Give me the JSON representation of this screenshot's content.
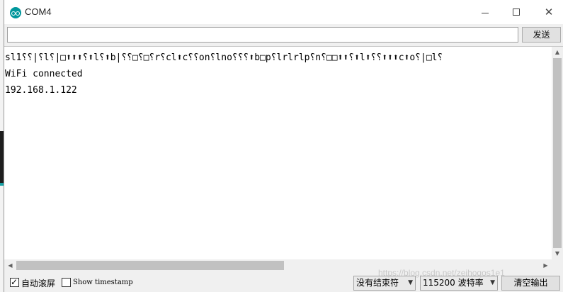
{
  "window": {
    "title": "COM4"
  },
  "title_bar_controls": {
    "close_glyph": "✕"
  },
  "input_row": {
    "value": "",
    "send_label": "发送"
  },
  "output": {
    "lines": [
      "sl1⸮⸮|⸮l⸮|□⬆⬆⬆⸮⬆l⸮⬆b|⸮⸮□⸮□⸮r⸮cl⬆c⸮⸮on⸮lno⸮⸮⸮⬆b□p⸮lrlrlp⸮n⸮□□⬆⬆⸮⬆l⬆⸮⸮⬆⬆⬆c⬆o⸮|□l⸮",
      "WiFi connected",
      "192.168.1.122"
    ]
  },
  "bottom_bar": {
    "autoscroll_label": "自动滚屏",
    "autoscroll_checked": true,
    "autoscroll_check_glyph": "✓",
    "timestamp_label": "Show timestamp",
    "timestamp_checked": false,
    "line_ending_value": "没有结束符",
    "baud_value": "115200 波特率",
    "clear_label": "清空输出"
  },
  "watermark": {
    "text": "https://blog.csdn.net/zeihoqos1e1"
  },
  "colors": {
    "app_icon": "#00979c",
    "background_panel": "#f0f0f0",
    "output_bg": "#ffffff"
  }
}
